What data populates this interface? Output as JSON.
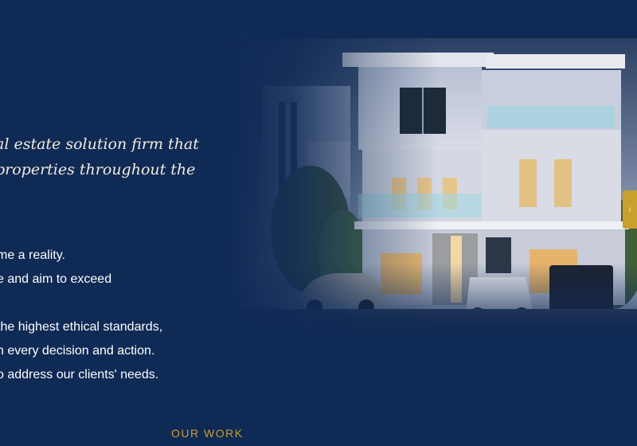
{
  "about": {
    "intro_lines": [
      "al estate solution firm that",
      " properties throughout the"
    ],
    "value_lines": [
      "me a reality.",
      "e and aim to exceed",
      "",
      " the highest ethical standards,",
      "n every decision and action.",
      "o address our clients' needs."
    ]
  },
  "sections": {
    "our_work_label": "OUR WORK"
  },
  "side_tab": {
    "label": "i"
  },
  "colors": {
    "background": "#0f2a55",
    "accent_gold": "#c9a02c",
    "intro_text": "#f0ecdf"
  }
}
